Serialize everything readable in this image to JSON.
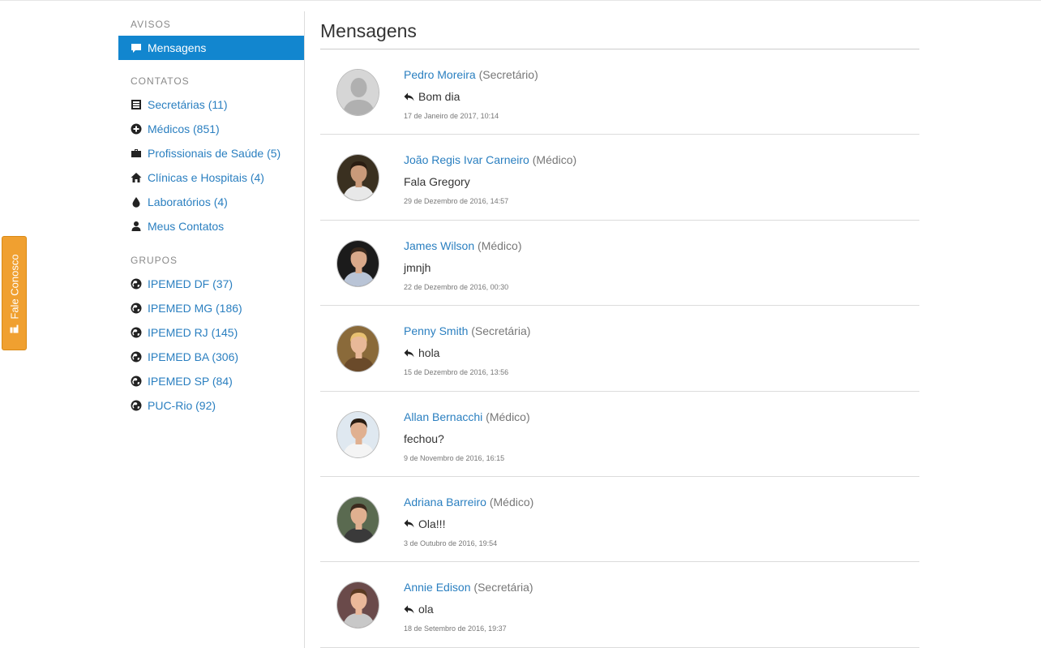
{
  "fale_tab": {
    "label": "Fale Conosco",
    "icon": "pointing-hand-icon",
    "color": "#f0a030"
  },
  "sidebar": {
    "avisos": {
      "title": "AVISOS",
      "items": [
        {
          "label": "Mensagens",
          "icon": "comment-icon",
          "active": true
        }
      ]
    },
    "contatos": {
      "title": "CONTATOS",
      "items": [
        {
          "label": "Secretárias (11)",
          "icon": "list-icon"
        },
        {
          "label": "Médicos (851)",
          "icon": "plus-circle-icon"
        },
        {
          "label": "Profissionais de Saúde (5)",
          "icon": "briefcase-icon"
        },
        {
          "label": "Clínicas e Hospitais (4)",
          "icon": "home-icon"
        },
        {
          "label": "Laboratórios (4)",
          "icon": "drop-icon"
        },
        {
          "label": "Meus Contatos",
          "icon": "user-icon"
        }
      ]
    },
    "grupos": {
      "title": "GRUPOS",
      "items": [
        {
          "label": "IPEMED DF (37)",
          "icon": "globe-icon"
        },
        {
          "label": "IPEMED MG (186)",
          "icon": "globe-icon"
        },
        {
          "label": "IPEMED RJ (145)",
          "icon": "globe-icon"
        },
        {
          "label": "IPEMED BA (306)",
          "icon": "globe-icon"
        },
        {
          "label": "IPEMED SP (84)",
          "icon": "globe-icon"
        },
        {
          "label": "PUC-Rio (92)",
          "icon": "globe-icon"
        }
      ]
    }
  },
  "main": {
    "title": "Mensagens",
    "messages": [
      {
        "name": "Pedro Moreira",
        "role": "(Secretário)",
        "text": "Bom dia",
        "replied": true,
        "date": "17 de Janeiro de 2017, 10:14",
        "avatar": {
          "bg": "#d6d6d6",
          "skin": "#bdbdbd",
          "shirt": "#bdbdbd",
          "hair": "#bdbdbd",
          "placeholder": true
        }
      },
      {
        "name": "João Regis Ivar Carneiro",
        "role": "(Médico)",
        "text": "Fala Gregory",
        "replied": false,
        "date": "29 de Dezembro de 2016, 14:57",
        "avatar": {
          "bg": "#3a3020",
          "skin": "#c99a7a",
          "shirt": "#e8e8e8",
          "hair": "#2a1d12"
        }
      },
      {
        "name": "James Wilson",
        "role": "(Médico)",
        "text": "jmnjh",
        "replied": false,
        "date": "22 de Dezembro de 2016, 00:30",
        "avatar": {
          "bg": "#1b1b1b",
          "skin": "#d9a98a",
          "shirt": "#b9c4d6",
          "hair": "#3b2a1e"
        }
      },
      {
        "name": "Penny Smith",
        "role": "(Secretária)",
        "text": "hola",
        "replied": true,
        "date": "15 de Dezembro de 2016, 13:56",
        "avatar": {
          "bg": "#8a6a3a",
          "skin": "#e8b898",
          "shirt": "#6a4a2a",
          "hair": "#e8c070"
        }
      },
      {
        "name": "Allan Bernacchi",
        "role": "(Médico)",
        "text": "fechou?",
        "replied": false,
        "date": "9 de Novembro de 2016, 16:15",
        "avatar": {
          "bg": "#dfe8f0",
          "skin": "#e0b090",
          "shirt": "#f4f4f4",
          "hair": "#2a1d12"
        }
      },
      {
        "name": "Adriana Barreiro",
        "role": "(Médico)",
        "text": "Ola!!!",
        "replied": true,
        "date": "3 de Outubro de 2016, 19:54",
        "avatar": {
          "bg": "#5a6a50",
          "skin": "#e0b090",
          "shirt": "#3a3a3a",
          "hair": "#3b2a1e"
        }
      },
      {
        "name": "Annie Edison",
        "role": "(Secretária)",
        "text": "ola",
        "replied": true,
        "date": "18 de Setembro de 2016, 19:37",
        "avatar": {
          "bg": "#6a4a4a",
          "skin": "#eab89a",
          "shirt": "#c8c8c8",
          "hair": "#5a3a22"
        }
      }
    ]
  }
}
